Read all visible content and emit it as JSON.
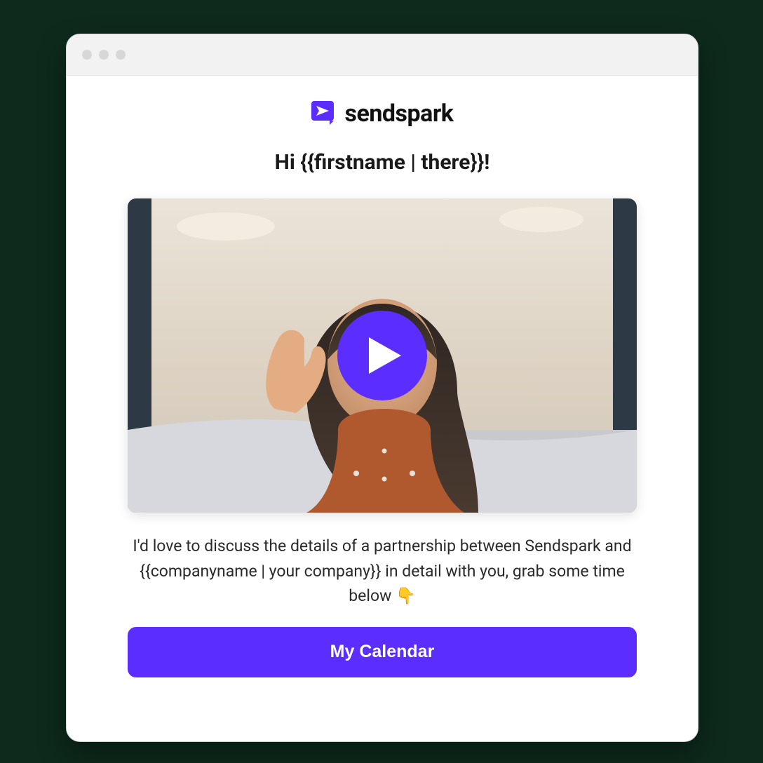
{
  "brand": {
    "name": "sendspark",
    "accent": "#5b2eff"
  },
  "greeting": "Hi {{firstname | there}}!",
  "message": "I'd love to discuss the details of a partnership between Sendspark and {{companyname | your company}} in detail with you, grab some time below 👇",
  "cta_label": "My Calendar",
  "icons": {
    "window_dots": "traffic-light-dots",
    "logo_mark": "sendspark-logo-icon",
    "play": "play-icon"
  }
}
